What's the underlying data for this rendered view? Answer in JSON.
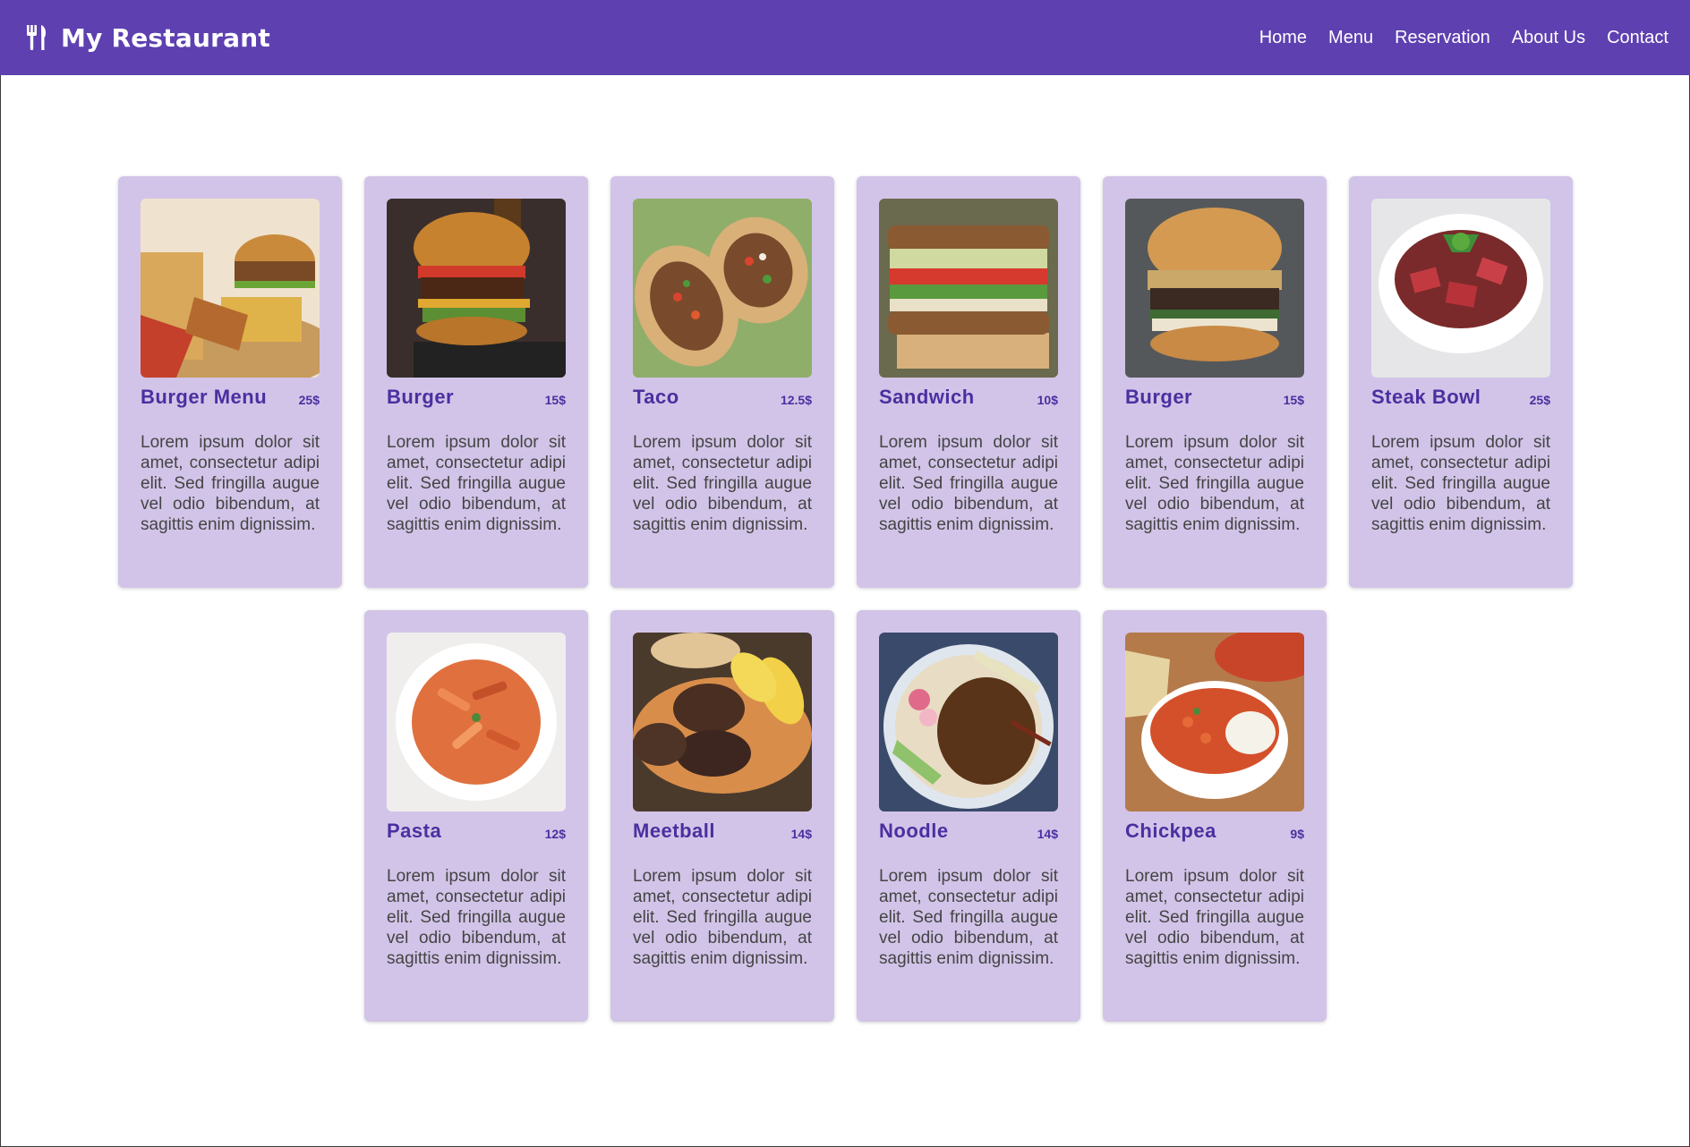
{
  "header": {
    "brand_icon": "utensils-icon",
    "brand_name": "My Restaurant",
    "nav": [
      {
        "label": "Home"
      },
      {
        "label": "Menu"
      },
      {
        "label": "Reservation"
      },
      {
        "label": "About Us"
      },
      {
        "label": "Contact"
      }
    ]
  },
  "colors": {
    "accent": "#5e40b0",
    "card_background": "#d2c4e8",
    "title": "#4b2fa0"
  },
  "menu": {
    "items": [
      {
        "name": "Burger Menu",
        "price": "25$",
        "description": "Lorem ipsum dolor sit amet, consectetur adipi elit. Sed fringilla augue vel odio bibendum, at sagittis enim dignissim.",
        "image": "burger-menu-photo"
      },
      {
        "name": "Burger",
        "price": "15$",
        "description": "Lorem ipsum dolor sit amet, consectetur adipi elit. Sed fringilla augue vel odio bibendum, at sagittis enim dignissim.",
        "image": "burger-photo"
      },
      {
        "name": "Taco",
        "price": "12.5$",
        "description": "Lorem ipsum dolor sit amet, consectetur adipi elit. Sed fringilla augue vel odio bibendum, at sagittis enim dignissim.",
        "image": "taco-photo"
      },
      {
        "name": "Sandwich",
        "price": "10$",
        "description": "Lorem ipsum dolor sit amet, consectetur adipi elit. Sed fringilla augue vel odio bibendum, at sagittis enim dignissim.",
        "image": "sandwich-photo"
      },
      {
        "name": "Burger",
        "price": "15$",
        "description": "Lorem ipsum dolor sit amet, consectetur adipi elit. Sed fringilla augue vel odio bibendum, at sagittis enim dignissim.",
        "image": "burger-photo"
      },
      {
        "name": "Steak Bowl",
        "price": "25$",
        "description": "Lorem ipsum dolor sit amet, consectetur adipi elit. Sed fringilla augue vel odio bibendum, at sagittis enim dignissim.",
        "image": "steak-bowl-photo"
      },
      {
        "name": "Pasta",
        "price": "12$",
        "description": "Lorem ipsum dolor sit amet, consectetur adipi elit. Sed fringilla augue vel odio bibendum, at sagittis enim dignissim.",
        "image": "pasta-photo"
      },
      {
        "name": "Meetball",
        "price": "14$",
        "description": "Lorem ipsum dolor sit amet, consectetur adipi elit. Sed fringilla augue vel odio bibendum, at sagittis enim dignissim.",
        "image": "meatball-photo"
      },
      {
        "name": "Noodle",
        "price": "14$",
        "description": "Lorem ipsum dolor sit amet, consectetur adipi elit. Sed fringilla augue vel odio bibendum, at sagittis enim dignissim.",
        "image": "noodle-photo"
      },
      {
        "name": "Chickpea",
        "price": "9$",
        "description": "Lorem ipsum dolor sit amet, consectetur adipi elit. Sed fringilla augue vel odio bibendum, at sagittis enim dignissim.",
        "image": "chickpea-photo"
      }
    ]
  }
}
